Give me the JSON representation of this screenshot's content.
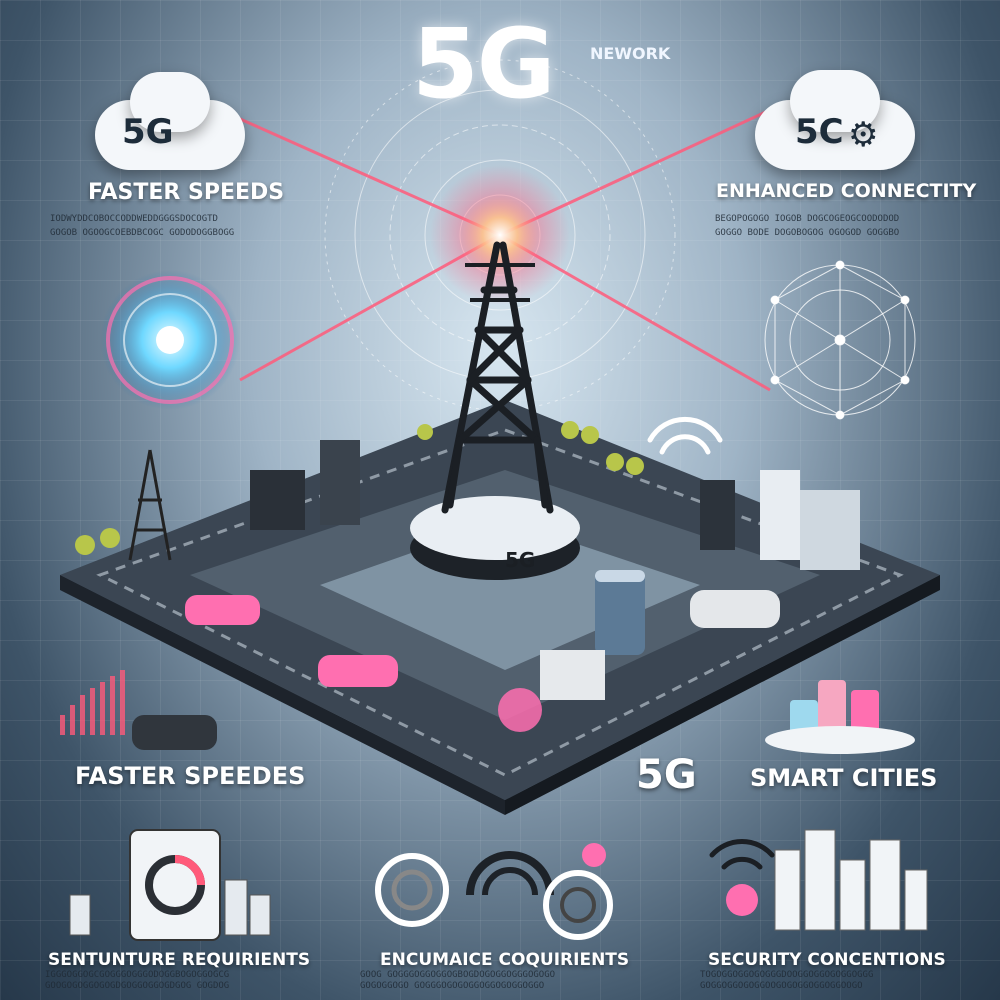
{
  "title": "5G",
  "title_suffix": "NEWORK",
  "tower_label": "5G",
  "center_label": "5G",
  "cloud_left_label": "5G",
  "cloud_right_label": "5C",
  "sections": {
    "top_left": "FASTER SPEEDS",
    "top_right": "ENHANCED CONNECTITY",
    "mid_left": "FASTER SPEEDES",
    "mid_right": "SMART CITIES",
    "bottom_left": "SENTUNTURE REQUIRIENTS",
    "bottom_center": "ENCUMAICE COQUIRIENTS",
    "bottom_right": "SECURITY CONCENTIONS"
  },
  "captions": {
    "top_left": [
      "IODWYDDCOBOCCODDWEDDGGGSDOCOGTD",
      "GOGOB OGOOGCOEBDBCOGC GODODOGGBOGG"
    ],
    "top_right": [
      "BEGOPOGOGO IOGOB DOGCOGEOGCOODODOD",
      "GOGGO BODE DOGOBOGOG OGOGOD GOGGBO"
    ],
    "bottom_left": [
      "IGGGOGGOGCGOGGGOGGGODOGGBOGOGGOGCG",
      "GOOGOGOGGOGOGDGOGGOGGOGDGOG GOGDOG"
    ],
    "bottom_center": [
      "GOOG GOGGGOGGOGGOGBOGDOGOGGOGGGOGOGO",
      "GOGOGGOGO GOGGGOGOGOGGOGGOGOGGOGGO"
    ],
    "bottom_right": [
      "TOGOGGOGGOGOGGGDOOGGOGGOGOGGOGGG",
      "GOGGOGGOGOGGOOGOGOGGOGGOGGOOGO"
    ]
  },
  "colors": {
    "laser": "#ff5a7a",
    "glow": "#ffd6a0",
    "accent_pink": "#ff6fb0",
    "tower": "#1b1f24"
  }
}
